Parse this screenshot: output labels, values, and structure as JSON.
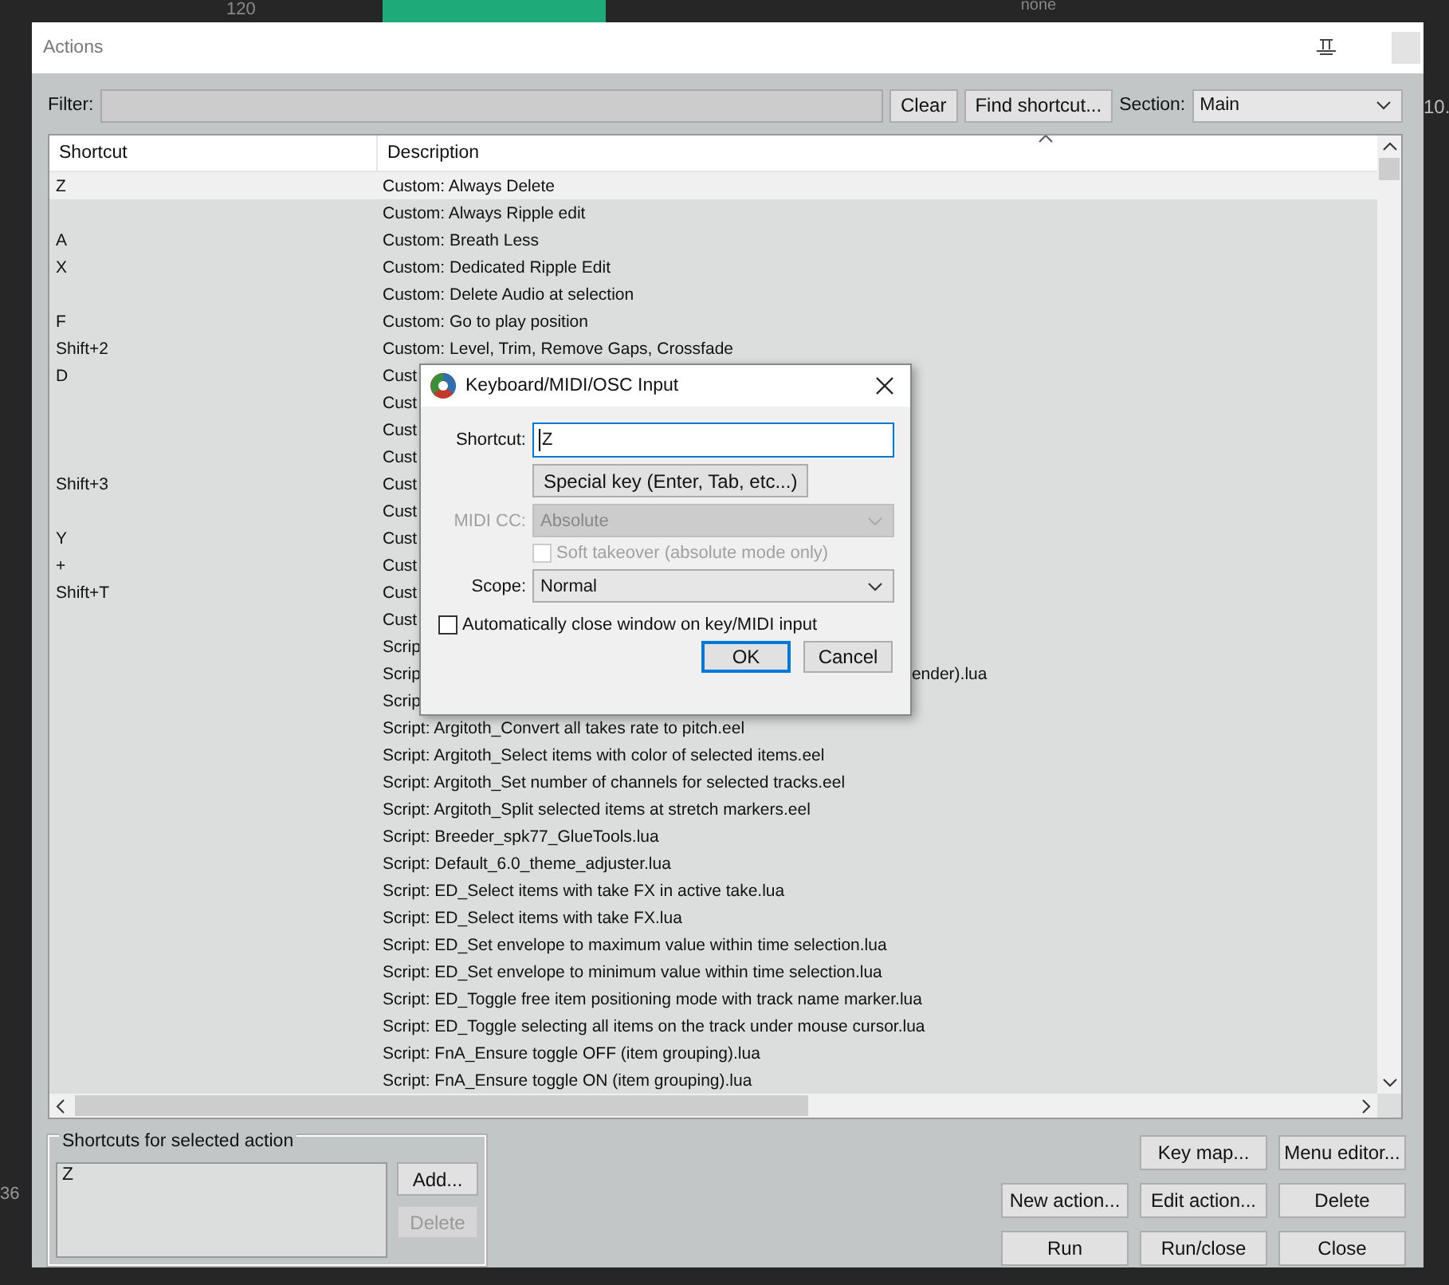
{
  "background_app": {
    "tempo": "120",
    "none_label": "none",
    "left_number": "36",
    "right_number": "10."
  },
  "window": {
    "title": "Actions"
  },
  "filter": {
    "label": "Filter:"
  },
  "top_buttons": [
    "Clear",
    "Find shortcut..."
  ],
  "section": {
    "label": "Section:",
    "value": "Main"
  },
  "table": {
    "columns": [
      "Shortcut",
      "Description"
    ],
    "rows": [
      {
        "shortcut": "Z",
        "description": "Custom: Always Delete",
        "selected": true
      },
      {
        "description": "Custom: Always Ripple edit",
        "selected": false
      },
      {
        "shortcut": "A",
        "description": "Custom: Breath Less",
        "selected": false
      },
      {
        "shortcut": "X",
        "description": "Custom: Dedicated Ripple Edit",
        "selected": false
      },
      {
        "description": "Custom: Delete Audio at selection",
        "selected": false
      },
      {
        "shortcut": "F",
        "description": "Custom: Go to play position",
        "selected": false
      },
      {
        "shortcut": "Shift+2",
        "description": "Custom: Level, Trim, Remove Gaps, Crossfade",
        "selected": false
      },
      {
        "shortcut": "D",
        "description": "Cust",
        "selected": false
      },
      {
        "description": "Cust",
        "selected": false
      },
      {
        "description": "Cust",
        "selected": false
      },
      {
        "description": "Cust",
        "selected": false
      },
      {
        "shortcut": "Shift+3",
        "description": "Cust",
        "selected": false
      },
      {
        "description": "Cust",
        "selected": false
      },
      {
        "shortcut": "Y",
        "description": "Cust",
        "selected": false
      },
      {
        "shortcut": "+",
        "description": "Cust",
        "selected": false
      },
      {
        "shortcut": "Shift+T",
        "description": "Cust",
        "selected": false
      },
      {
        "description": "Cust",
        "selected": false
      },
      {
        "description": "Scrip",
        "selected": false
      },
      {
        "description": "Scrip",
        "tail": "ender).lua",
        "selected": false
      },
      {
        "description": "Scrip",
        "selected": false
      },
      {
        "description": "Script: Argitoth_Convert all takes rate to pitch.eel",
        "selected": false
      },
      {
        "description": "Script: Argitoth_Select items with color of selected items.eel",
        "selected": false
      },
      {
        "description": "Script: Argitoth_Set number of channels for selected tracks.eel",
        "selected": false
      },
      {
        "description": "Script: Argitoth_Split selected items at stretch markers.eel",
        "selected": false
      },
      {
        "description": "Script: Breeder_spk77_GlueTools.lua",
        "selected": false
      },
      {
        "description": "Script: Default_6.0_theme_adjuster.lua",
        "selected": false
      },
      {
        "description": "Script: ED_Select items with take FX in active take.lua",
        "selected": false
      },
      {
        "description": "Script: ED_Select items with take FX.lua",
        "selected": false
      },
      {
        "description": "Script: ED_Set envelope to maximum value within time selection.lua",
        "selected": false
      },
      {
        "description": "Script: ED_Set envelope to minimum value within time selection.lua",
        "selected": false
      },
      {
        "description": "Script: ED_Toggle free item positioning mode with track name marker.lua",
        "selected": false
      },
      {
        "description": "Script: ED_Toggle selecting all items on the track under mouse cursor.lua",
        "selected": false
      },
      {
        "description": "Script: FnA_Ensure toggle OFF (item grouping).lua",
        "selected": false
      },
      {
        "description": "Script: FnA_Ensure toggle ON (item grouping).lua",
        "selected": false
      }
    ]
  },
  "shortcuts_group": {
    "title": "Shortcuts for selected action",
    "items": [
      "Z"
    ],
    "buttons": [
      {
        "label": "Add...",
        "disabled": false
      },
      {
        "label": "Delete",
        "disabled": true
      }
    ]
  },
  "action_buttons": [
    [
      "Key map...",
      "Menu editor..."
    ],
    [
      "New action...",
      "Edit action...",
      "Delete"
    ],
    [
      "Run",
      "Run/close",
      "Close"
    ]
  ],
  "dialog": {
    "title": "Keyboard/MIDI/OSC Input",
    "shortcut_label": "Shortcut:",
    "shortcut_value": "Z",
    "special_key_button": "Special key (Enter, Tab, etc...)",
    "midi_cc": {
      "label": "MIDI CC:",
      "value": "Absolute",
      "disabled": true
    },
    "soft_takeover": {
      "label": "Soft takeover (absolute mode only)",
      "checked": false,
      "disabled": true
    },
    "scope": {
      "label": "Scope:",
      "value": "Normal"
    },
    "auto_close": {
      "label": "Automatically close window on key/MIDI input",
      "checked": false
    },
    "buttons": [
      {
        "label": "OK",
        "default": true
      },
      {
        "label": "Cancel",
        "default": false
      }
    ]
  }
}
